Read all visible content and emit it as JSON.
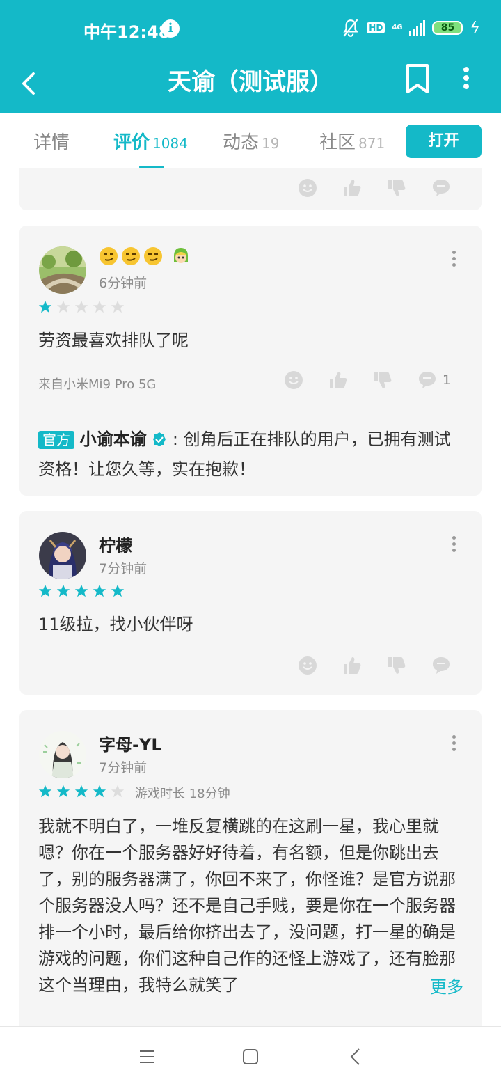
{
  "status": {
    "time": "中午12:48",
    "network": "4G",
    "battery": "85"
  },
  "app": {
    "title": "天谕（测试服）"
  },
  "tabs": [
    {
      "label": "详情",
      "count": ""
    },
    {
      "label": "评价",
      "count": "1084"
    },
    {
      "label": "动态",
      "count": "19"
    },
    {
      "label": "社区",
      "count": "871"
    }
  ],
  "open_button": "打开",
  "reviews": [
    {
      "name": "",
      "time": "6分钟前",
      "stars": 1,
      "text": "劳资最喜欢排队了呢",
      "device": "来自小米Mi9 Pro 5G",
      "comment_count": "1",
      "official_reply": {
        "badge": "官方",
        "name": "小谕本谕",
        "text": ": 创角后正在排队的用户，已拥有测试资格！让您久等，实在抱歉！"
      }
    },
    {
      "name": "柠檬",
      "time": "7分钟前",
      "stars": 5,
      "text": "11级拉，找小伙伴呀"
    },
    {
      "name": "字母-YL",
      "time": "7分钟前",
      "stars": 4,
      "playtime": "游戏时长 18分钟",
      "text": "我就不明白了，一堆反复横跳的在这刷一星，我心里就嗯？你在一个服务器好好待着，有名额，但是你跳出去了，别的服务器满了，你回不来了，你怪谁？是官方说那个服务器没人吗？还不是自己手贱，要是你在一个服务器排一个小时，最后给你挤出去了，没问题，打一星的确是游戏的问题，你们这种自己作的还怪上游戏了，还有脸那这个当理由，我特么就笑了",
      "more": "更多"
    }
  ],
  "colors": {
    "accent": "#14b9c8",
    "card": "#f5f5f5"
  }
}
